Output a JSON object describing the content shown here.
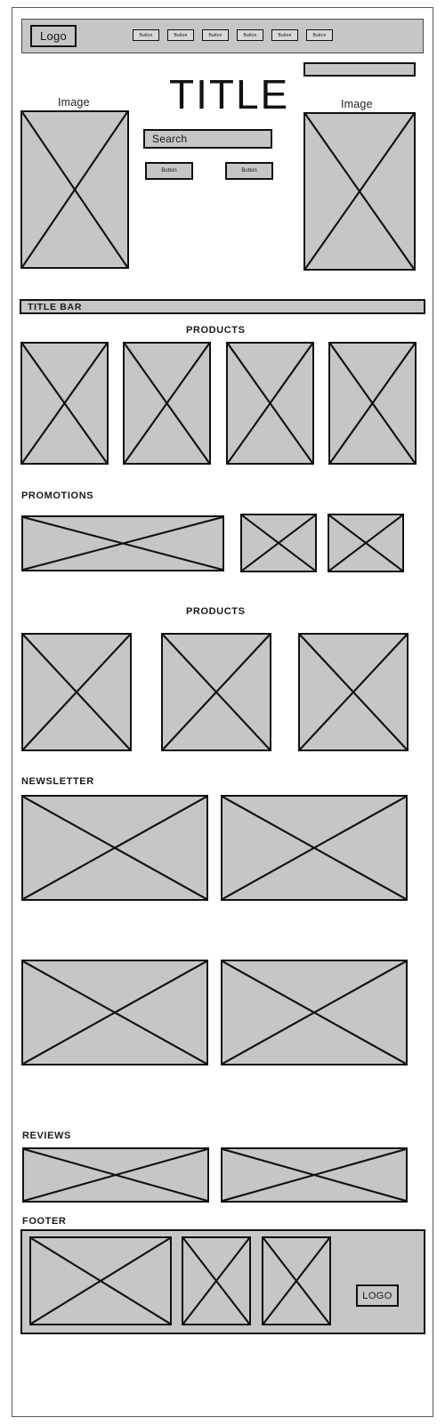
{
  "page": {
    "title": "Website Wireframe Mockup",
    "background_color": "#ffffff",
    "placeholder_fill": "#c6c6c6",
    "stroke_color": "#111111"
  },
  "header": {
    "logo_label": "Logo",
    "nav_buttons": [
      {
        "label": "Button"
      },
      {
        "label": "Button"
      },
      {
        "label": "Button"
      },
      {
        "label": "Button"
      },
      {
        "label": "Button"
      },
      {
        "label": "Button"
      }
    ]
  },
  "hero": {
    "title": "TITLE",
    "search_placeholder": "Search",
    "left_image_label": "Image",
    "right_image_label": "Image",
    "buttons": [
      {
        "label": "Button"
      },
      {
        "label": "Button"
      }
    ]
  },
  "title_bar": {
    "label": "TITLE BAR"
  },
  "sections": {
    "products_top": {
      "heading": "PRODUCTS",
      "align": "center",
      "tile_count": 4
    },
    "promotions": {
      "heading": "PROMOTIONS",
      "align": "left",
      "tile_count": 3
    },
    "products_mid": {
      "heading": "PRODUCTS",
      "align": "center",
      "tile_count": 3
    },
    "newsletter": {
      "heading": "NEWSLETTER",
      "align": "left",
      "tile_count": 4
    },
    "reviews": {
      "heading": "REVIEWS",
      "align": "left",
      "tile_count": 2
    },
    "footer": {
      "heading": "FOOTER",
      "align": "left",
      "tile_count": 3,
      "logo_label": "LOGO"
    }
  }
}
